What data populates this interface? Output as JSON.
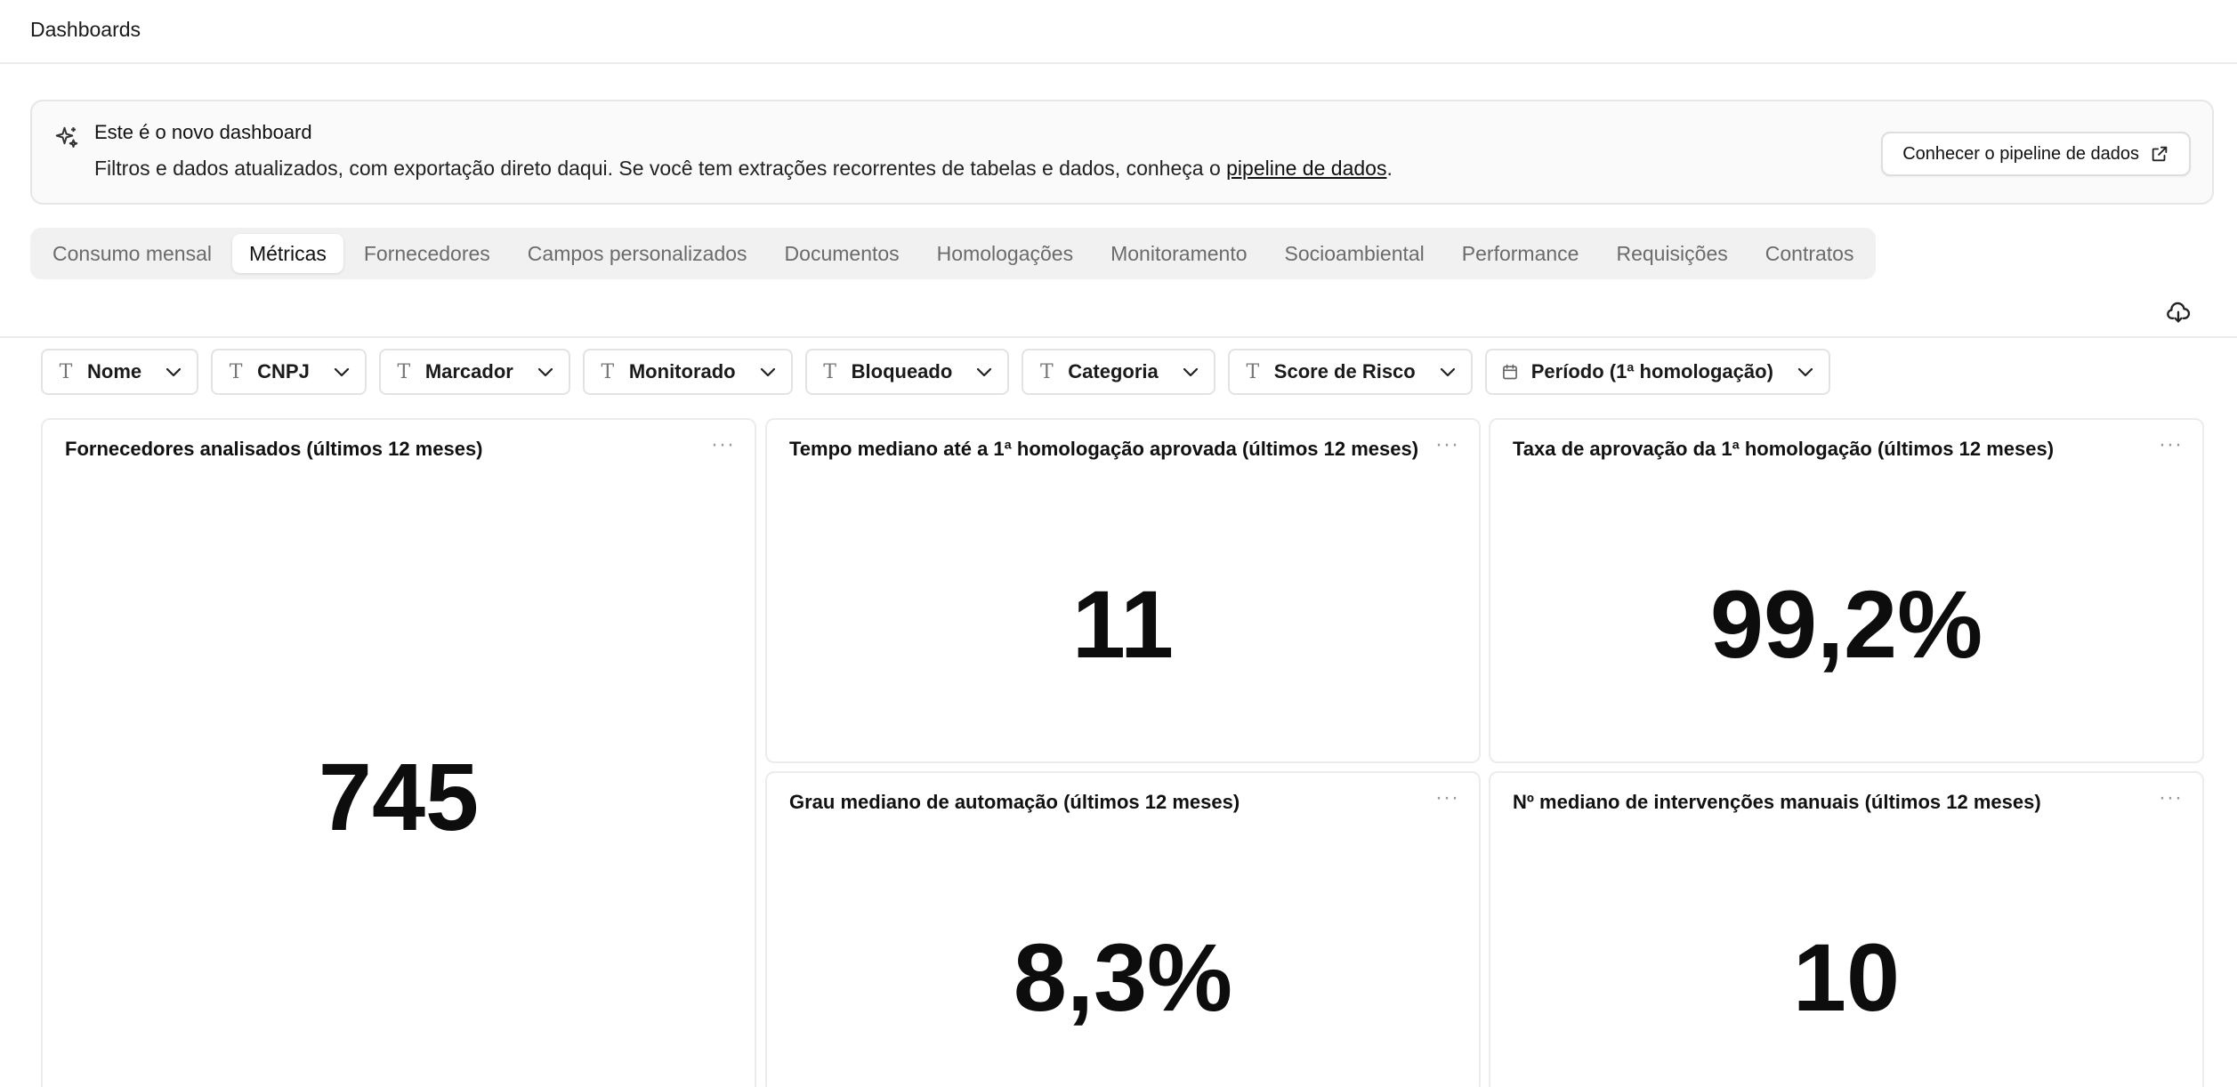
{
  "header": {
    "title": "Dashboards"
  },
  "banner": {
    "icon": "sparkles-icon",
    "title": "Este é o novo dashboard",
    "text_before": "Filtros e dados atualizados, com exportação direto daqui. Se você tem extrações recorrentes de tabelas e dados, conheça o ",
    "link_text": "pipeline de dados",
    "text_after": ".",
    "cta_label": "Conhecer o pipeline de dados",
    "cta_icon": "external-link-icon"
  },
  "tabs": [
    {
      "label": "Consumo mensal",
      "active": false
    },
    {
      "label": "Métricas",
      "active": true
    },
    {
      "label": "Fornecedores",
      "active": false
    },
    {
      "label": "Campos personalizados",
      "active": false
    },
    {
      "label": "Documentos",
      "active": false
    },
    {
      "label": "Homologações",
      "active": false
    },
    {
      "label": "Monitoramento",
      "active": false
    },
    {
      "label": "Socioambiental",
      "active": false
    },
    {
      "label": "Performance",
      "active": false
    },
    {
      "label": "Requisições",
      "active": false
    },
    {
      "label": "Contratos",
      "active": false
    }
  ],
  "toolbar": {
    "download_icon": "cloud-download-icon"
  },
  "filters": [
    {
      "label": "Nome",
      "icon": "text-type-icon"
    },
    {
      "label": "CNPJ",
      "icon": "text-type-icon"
    },
    {
      "label": "Marcador",
      "icon": "text-type-icon"
    },
    {
      "label": "Monitorado",
      "icon": "text-type-icon"
    },
    {
      "label": "Bloqueado",
      "icon": "text-type-icon"
    },
    {
      "label": "Categoria",
      "icon": "text-type-icon"
    },
    {
      "label": "Score de Risco",
      "icon": "text-type-icon"
    },
    {
      "label": "Período (1ª homologação)",
      "icon": "calendar-icon"
    }
  ],
  "cards": [
    {
      "title": "Fornecedores analisados (últimos 12 meses)",
      "value": "745"
    },
    {
      "title": "Tempo mediano até a 1ª homologação aprovada (últimos 12 meses)",
      "value": "11"
    },
    {
      "title": "Taxa de aprovação da 1ª homologação (últimos 12 meses)",
      "value": "99,2%"
    },
    {
      "title": "Grau mediano de automação (últimos 12 meses)",
      "value": "8,3%"
    },
    {
      "title": "Nº mediano de intervenções manuais (últimos 12 meses)",
      "value": "10"
    }
  ],
  "card_menu_label": "···"
}
